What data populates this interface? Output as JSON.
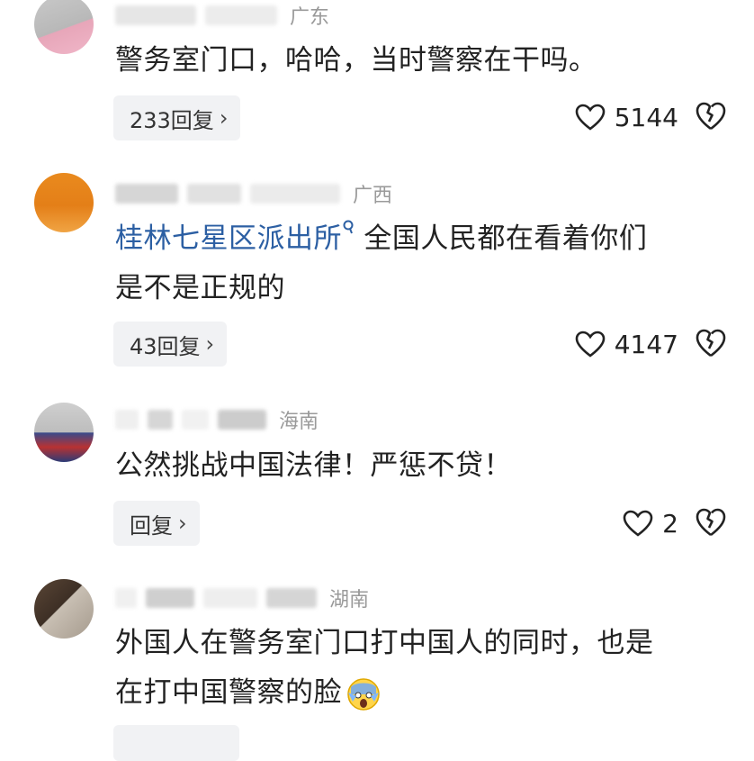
{
  "comments": [
    {
      "region": "广东",
      "text": "警务室门口，哈哈，当时警察在干吗。",
      "reply_label": "233回复",
      "likes": "5144"
    },
    {
      "region": "广西",
      "mention": "桂林七星区派出所",
      "text_line1": "全国人民都在看着你们",
      "text_line2": "是不是正规的",
      "reply_label": "43回复",
      "likes": "4147"
    },
    {
      "region": "海南",
      "text": "公然挑战中国法律！严惩不贷！",
      "reply_label": "回复",
      "likes": "2"
    },
    {
      "region": "湖南",
      "text_line1": "外国人在警务室门口打中国人的同时，也是",
      "text_line2": "在打中国警察的脸"
    }
  ],
  "icons": {
    "like": "heart-outline-icon",
    "dislike": "broken-heart-icon",
    "chevron": "chevron-right-icon",
    "mention": "search-link-icon",
    "emoji": "shocked-face-emoji"
  }
}
